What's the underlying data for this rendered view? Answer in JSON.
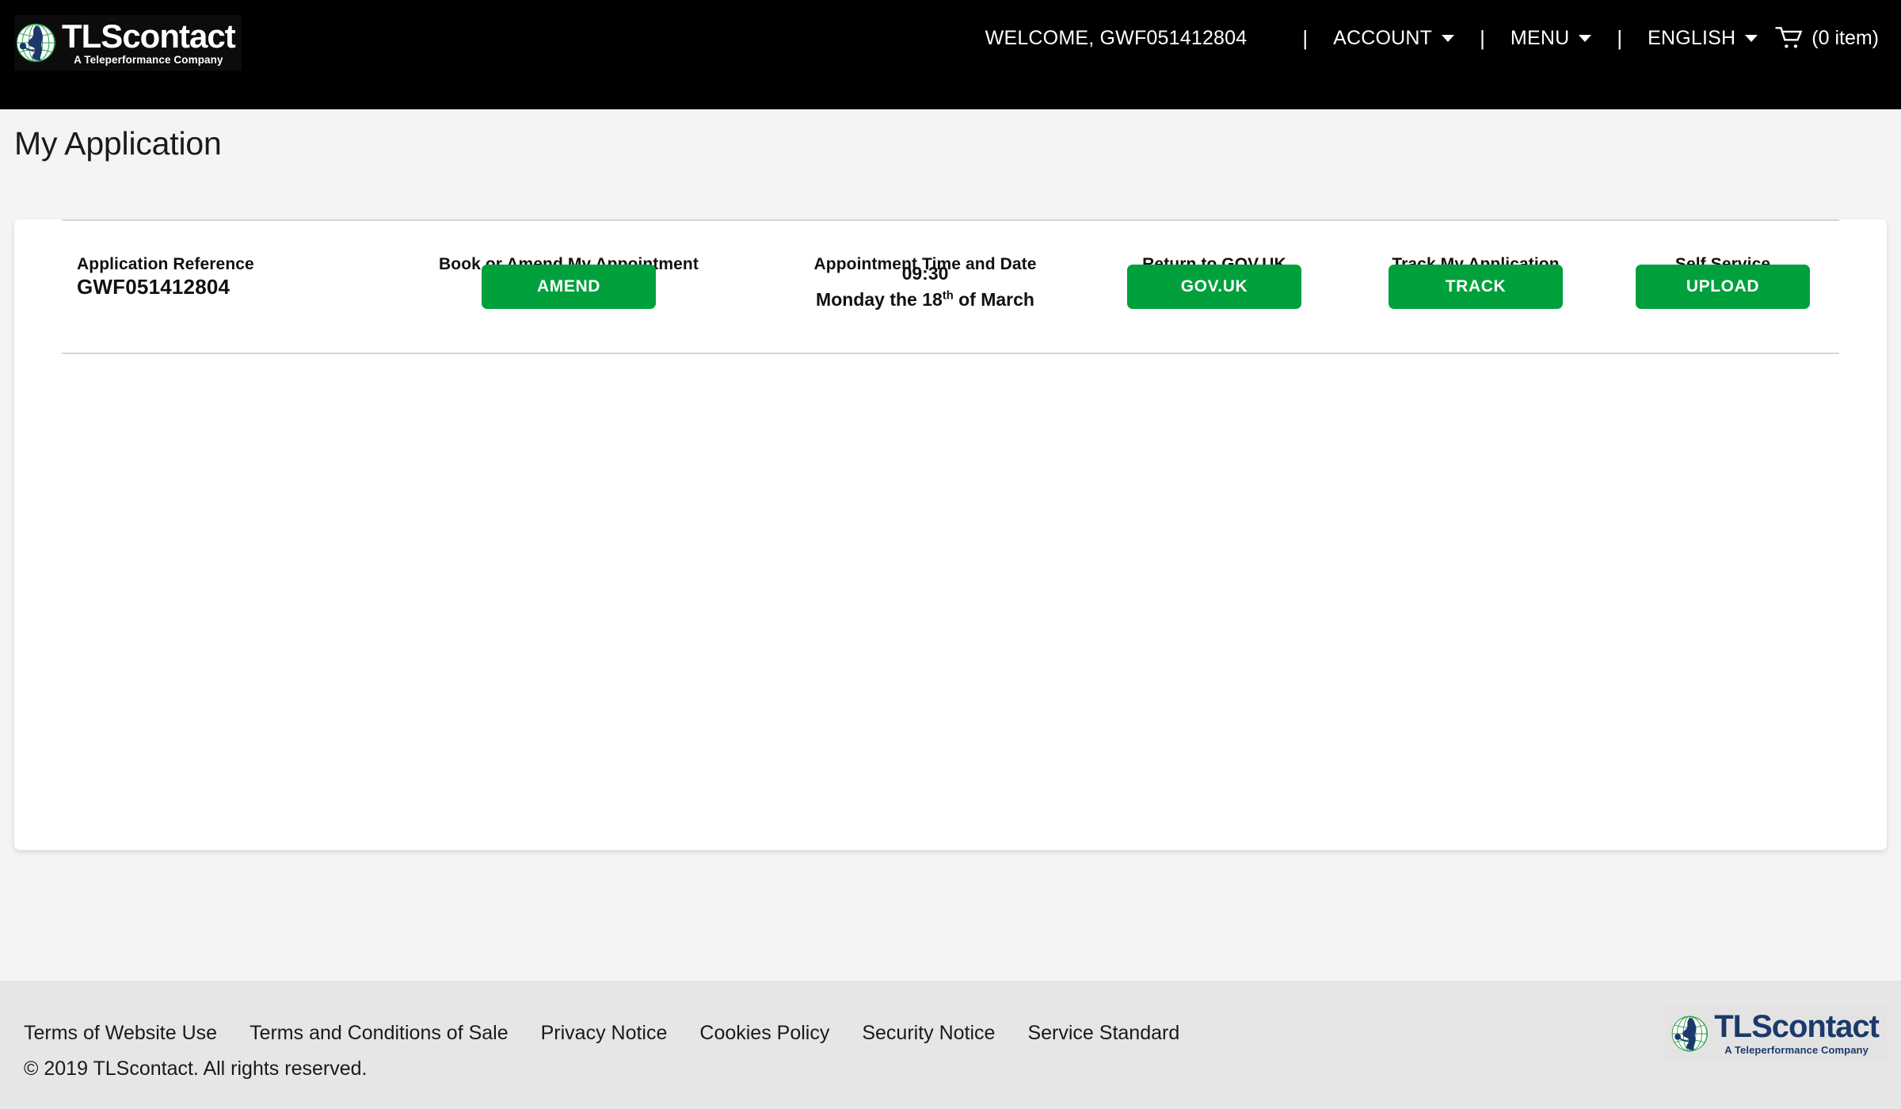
{
  "header": {
    "logo": {
      "icon": "globe-icon",
      "name": "TLScontact",
      "tagline": "A Teleperformance Company"
    },
    "welcome": "WELCOME, GWF051412804",
    "separator": "|",
    "nav_items": [
      {
        "label": "ACCOUNT",
        "caret": "chevron-down-icon"
      },
      {
        "label": "MENU",
        "caret": "chevron-down-icon"
      },
      {
        "label": "ENGLISH",
        "caret": "chevron-down-icon"
      }
    ],
    "cart": {
      "icon": "shopping-cart-icon",
      "count_label": "(0 item)"
    }
  },
  "page": {
    "title": "My Application"
  },
  "table": {
    "columns": [
      "Application Reference",
      "Book or Amend My Appointment",
      "Appointment Time and Date",
      "Return to GOV.UK",
      "Track My Application",
      "Self Service"
    ],
    "row": {
      "application_reference": "GWF051412804",
      "amend_button": "AMEND",
      "appointment_time": "09:30",
      "appointment_date_prefix": "Monday the 18",
      "appointment_date_ordinal": "th",
      "appointment_date_suffix": " of March",
      "gov_uk_button": "GOV.UK",
      "track_button": "TRACK",
      "upload_button": "UPLOAD"
    }
  },
  "footer": {
    "links": [
      "Terms of Website Use",
      "Terms and Conditions of Sale",
      "Privacy Notice",
      "Cookies Policy",
      "Security Notice",
      "Service Standard"
    ],
    "copyright": "© 2019 TLScontact. All rights reserved.",
    "logo": {
      "icon": "globe-icon",
      "name": "TLScontact",
      "tagline": "A Teleperformance Company"
    }
  },
  "colors": {
    "accent_green": "#00a03c",
    "header_black": "#000000",
    "page_background": "#f4f4f4",
    "footer_background": "#e6e6e6",
    "brand_navy": "#1b3a6b",
    "divider": "#d6d6d6"
  }
}
